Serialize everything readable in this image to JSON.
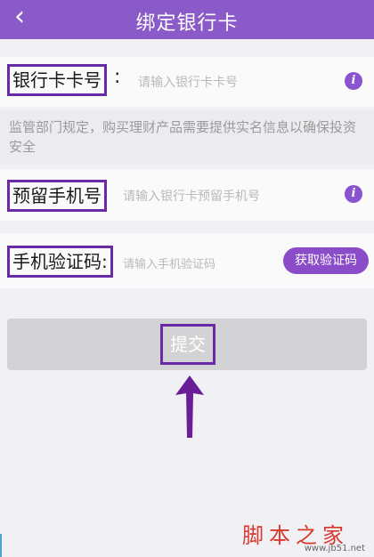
{
  "header": {
    "back_icon": "chevron-left-icon",
    "title": "绑定银行卡"
  },
  "card_number": {
    "label": "银行卡卡号",
    "separator": ":",
    "placeholder": "请输入银行卡卡号",
    "info_icon": "info-icon"
  },
  "notice": {
    "text": "监管部门规定，购买理财产品需要提供实名信息以确保投资安全"
  },
  "phone": {
    "label": "预留手机号",
    "placeholder": "请输入银行卡预留手机号",
    "info_icon": "info-icon"
  },
  "verify": {
    "label": "手机验证码:",
    "placeholder": "请输入手机验证码",
    "get_code_label": "获取验证码"
  },
  "submit": {
    "label": "提交"
  },
  "watermark": {
    "big": "脚本之家",
    "small": "www.jb51.net"
  },
  "colors": {
    "header": "#8a5ac8",
    "accent": "#8a4cc8",
    "highlight_box": "#6a2aa5",
    "arrow": "#6a1f96"
  }
}
